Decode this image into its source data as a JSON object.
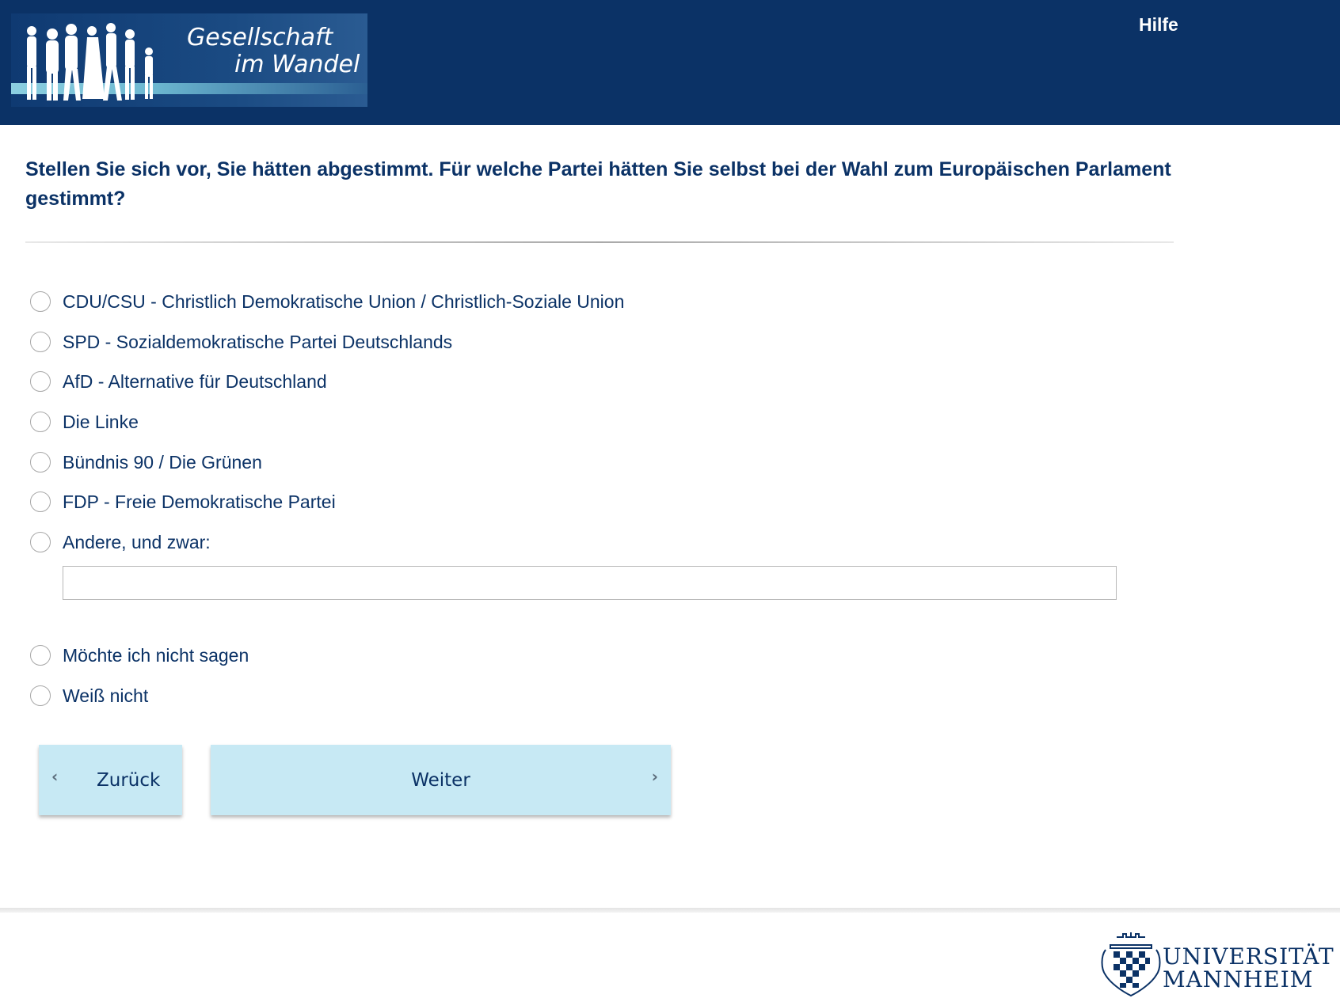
{
  "header": {
    "logo_line1": "Gesellschaft",
    "logo_line2": "im Wandel",
    "help_label": "Hilfe",
    "background_color": "#0b3266"
  },
  "question": {
    "text": "Stellen Sie sich vor, Sie hätten abgestimmt. Für welche Partei hätten Sie selbst bei der Wahl zum Europäischen Parlament gestimmt?"
  },
  "options": [
    {
      "label": "CDU/CSU - Christlich Demokratische Union / Christlich-Soziale Union",
      "selected": false
    },
    {
      "label": "SPD - Sozialdemokratische Partei Deutschlands",
      "selected": false
    },
    {
      "label": "AfD - Alternative für Deutschland",
      "selected": false
    },
    {
      "label": "Die Linke",
      "selected": false
    },
    {
      "label": "Bündnis 90 / Die Grünen",
      "selected": false
    },
    {
      "label": "FDP - Freie Demokratische Partei",
      "selected": false
    },
    {
      "label": "Andere, und zwar:",
      "selected": false
    },
    {
      "label": "Möchte ich nicht sagen",
      "selected": false
    },
    {
      "label": "Weiß nicht",
      "selected": false
    }
  ],
  "other_input": {
    "value": ""
  },
  "navigation": {
    "back_label": "Zurück",
    "next_label": "Weiter",
    "button_color": "#c7e9f4"
  },
  "footer": {
    "university_line1": "UNIVERSITÄT",
    "university_line2": "MANNHEIM"
  }
}
